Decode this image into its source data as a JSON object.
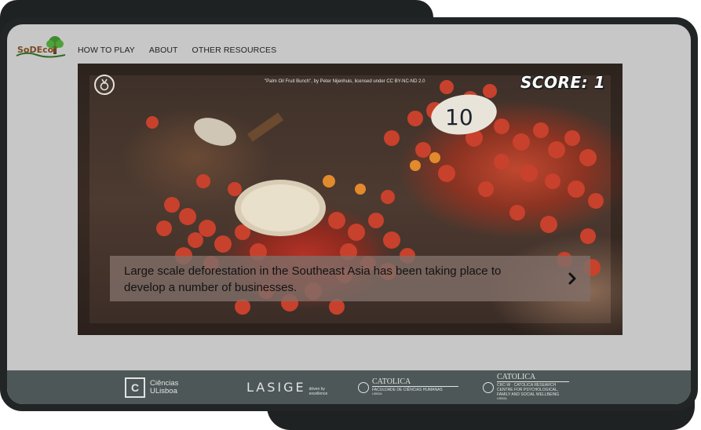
{
  "nav": {
    "links": [
      "HOW TO PLAY",
      "ABOUT",
      "OTHER RESOURCES"
    ]
  },
  "logo": {
    "text": "SoDEcol",
    "icon": "tree-icon"
  },
  "image": {
    "attribution": "\"Palm Oil Fruit Bunch\", by Peter Nijenhuis, licensed under CC BY-NC-ND 2.0",
    "tag_number": "10"
  },
  "game": {
    "score_label": "SCORE:",
    "score_value": "1",
    "badge_icon": "medal-icon",
    "dialog_text": "Large scale deforestation in the Southeast Asia has been taking place to develop a number of businesses.",
    "next_icon": "chevron-right-icon"
  },
  "footer": {
    "ciencias": {
      "letter": "C",
      "line1": "Ciências",
      "line2": "ULisboa"
    },
    "lasige": {
      "word": "LASIGE",
      "tagline": "driven by excellence"
    },
    "catolica1": {
      "title": "CATOLICA",
      "sub": "FACULDADE DE CIÊNCIAS HUMANAS",
      "city": "LISBOA"
    },
    "catolica2": {
      "title": "CATOLICA",
      "sub": "CRC-W · CATOLICA RESEARCH CENTRE FOR PSYCHOLOGICAL, FAMILY AND SOCIAL WELLBEING",
      "city": "LISBOA"
    }
  },
  "colors": {
    "screen_bg": "#c7c7c7",
    "footer_bg": "#4e5757",
    "device_frame": "#222526",
    "dialog_bg": "#806e68"
  }
}
